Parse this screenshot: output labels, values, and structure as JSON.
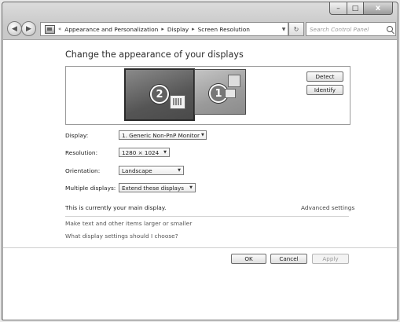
{
  "window": {
    "caption": {
      "minimize": "–",
      "maximize": "□",
      "close": "x"
    }
  },
  "nav": {
    "overflow": "«",
    "breadcrumbs": [
      "Appearance and Personalization",
      "Display",
      "Screen Resolution"
    ],
    "separator": "▸",
    "search_placeholder": "Search Control Panel"
  },
  "page": {
    "title": "Change the appearance of your displays",
    "preview": {
      "monitors": [
        {
          "number": "2",
          "selected": true
        },
        {
          "number": "1",
          "selected": false
        }
      ],
      "detect_label": "Detect",
      "identify_label": "Identify"
    },
    "form": {
      "display": {
        "label": "Display:",
        "value": "1. Generic Non-PnP Monitor"
      },
      "resolution": {
        "label": "Resolution:",
        "value": "1280 × 1024"
      },
      "orientation": {
        "label": "Orientation:",
        "value": "Landscape"
      },
      "multiple": {
        "label": "Multiple displays:",
        "value": "Extend these displays"
      }
    },
    "main_display_note": "This is currently your main display.",
    "advanced_settings": "Advanced settings",
    "links": {
      "text_size": "Make text and other items larger or smaller",
      "help": "What display settings should I choose?"
    },
    "buttons": {
      "ok": "OK",
      "cancel": "Cancel",
      "apply": "Apply"
    }
  }
}
